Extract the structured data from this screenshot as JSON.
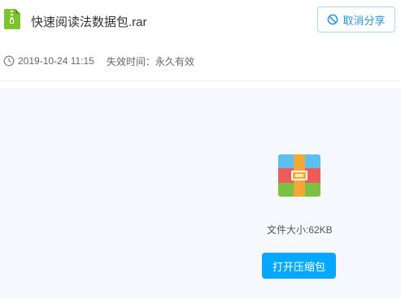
{
  "file": {
    "name": "快速阅读法数据包.rar",
    "icon": "zip-file-icon",
    "icon_color": "#7dc42c"
  },
  "header": {
    "cancel_share_label": "取消分享",
    "cancel_icon": "prohibited-icon"
  },
  "meta": {
    "clock_icon": "clock-icon",
    "share_time": "2019-10-24 11:15",
    "expire_text": "失效时间：永久有效"
  },
  "preview": {
    "icon": "archive-rar-icon",
    "file_size_text": "文件大小:62KB",
    "open_button_label": "打开压缩包"
  },
  "colors": {
    "accent": "#06a7ff",
    "link_blue": "#2a95d9",
    "panel_bg": "#f5f8fc"
  }
}
